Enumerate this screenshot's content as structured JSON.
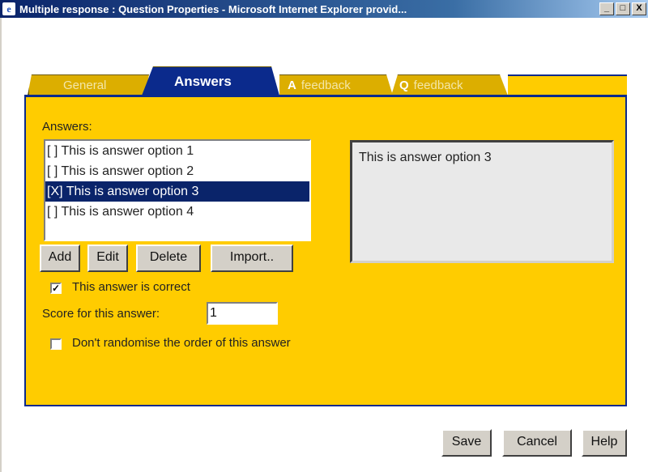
{
  "window": {
    "title": "Multiple response : Question Properties - Microsoft Internet Explorer provid...",
    "minimize": "_",
    "maximize": "□",
    "close": "X"
  },
  "tabs": {
    "general": "General",
    "answers": "Answers",
    "a_feedback_prefix": "A",
    "a_feedback": "feedback",
    "q_feedback_prefix": "Q",
    "q_feedback": "feedback"
  },
  "answers_panel": {
    "label": "Answers:",
    "options": [
      "[ ] This is answer option 1",
      "[ ] This is answer option 2",
      "[X] This is answer option 3",
      "[ ] This is answer option 4"
    ],
    "selected_index": 2,
    "preview_text": "This is answer option 3",
    "buttons": {
      "add": "Add",
      "edit": "Edit",
      "delete": "Delete",
      "import": "Import.."
    },
    "correct_checkbox": {
      "label": "This answer is correct",
      "checked": true,
      "mark": "✓"
    },
    "score_label": "Score for this answer:",
    "score_value": "1",
    "randomise_checkbox": {
      "label": "Don't randomise the order of this answer",
      "checked": false
    }
  },
  "footer": {
    "save": "Save",
    "cancel": "Cancel",
    "help": "Help"
  },
  "colors": {
    "panel": "#ffcc00",
    "active_tab": "#0b2a8c",
    "selection": "#0a246a"
  }
}
